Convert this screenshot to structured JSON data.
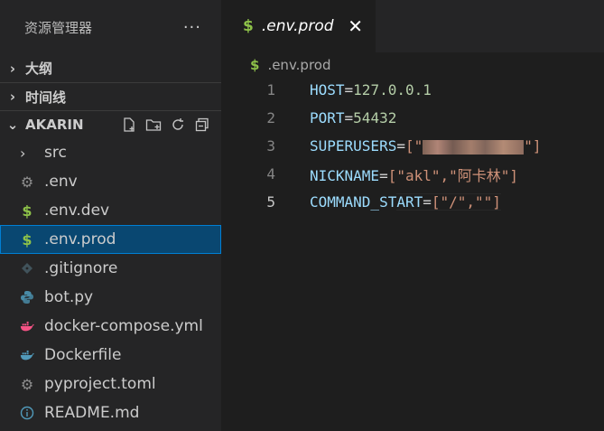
{
  "explorer": {
    "title": "资源管理器",
    "more": "···",
    "sections": {
      "outline": "大纲",
      "timeline": "时间线"
    },
    "project": "AKARIN",
    "files": [
      {
        "name": "src",
        "icon": "chevron-right-icon"
      },
      {
        "name": ".env",
        "icon": "gear-icon"
      },
      {
        "name": ".env.dev",
        "icon": "dollar-icon"
      },
      {
        "name": ".env.prod",
        "icon": "dollar-icon",
        "selected": true
      },
      {
        "name": ".gitignore",
        "icon": "git-icon"
      },
      {
        "name": "bot.py",
        "icon": "python-icon"
      },
      {
        "name": "docker-compose.yml",
        "icon": "docker-icon"
      },
      {
        "name": "Dockerfile",
        "icon": "docker-icon"
      },
      {
        "name": "pyproject.toml",
        "icon": "gear-icon"
      },
      {
        "name": "README.md",
        "icon": "info-icon"
      }
    ]
  },
  "editor": {
    "tab": {
      "label": ".env.prod",
      "close": "✕"
    },
    "breadcrumb": ".env.prod",
    "lines": [
      {
        "n": "1",
        "key": "HOST",
        "val": "127.0.0.1"
      },
      {
        "n": "2",
        "key": "PORT",
        "val": "54432"
      },
      {
        "n": "3",
        "key": "SUPERUSERS",
        "val": "[\"",
        "val_end": "\"]"
      },
      {
        "n": "4",
        "key": "NICKNAME",
        "val": "[\"akl\",\"阿卡林\"]"
      },
      {
        "n": "5",
        "key": "COMMAND_START",
        "val": "[\"/\",\"\"]"
      }
    ]
  },
  "colors": {
    "accent": "#007fd4",
    "selection": "#094771",
    "dollar": "#8dc149"
  }
}
